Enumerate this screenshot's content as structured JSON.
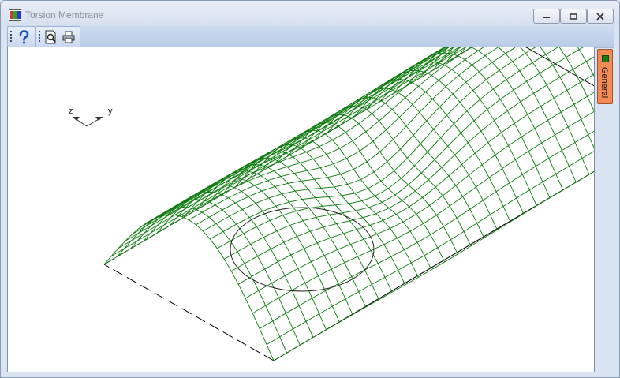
{
  "window": {
    "title": "Torsion Membrane"
  },
  "toolbar": {
    "help_icon": "question-mark-icon",
    "preview_icon": "print-preview-icon",
    "print_icon": "printer-icon"
  },
  "axes_indicator": {
    "z_label": "z",
    "y_label": "y"
  },
  "side_panel": {
    "tab_label": "General",
    "tab_color": "#f58a55"
  },
  "plot": {
    "mesh_color": "#0a7a0a",
    "outline_color": "#000000"
  }
}
